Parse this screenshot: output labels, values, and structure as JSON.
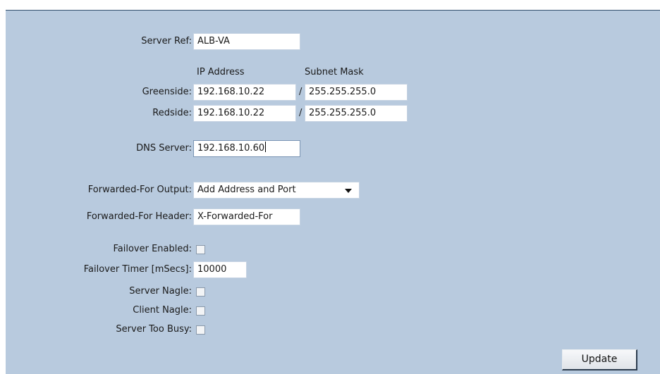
{
  "server_ref": {
    "label": "Server Ref:",
    "value": "ALB-VA"
  },
  "columns": {
    "ip": "IP Address",
    "subnet": "Subnet Mask"
  },
  "greenside": {
    "label": "Greenside:",
    "ip": "192.168.10.22",
    "separator": "/",
    "subnet": "255.255.255.0"
  },
  "redside": {
    "label": "Redside:",
    "ip": "192.168.10.22",
    "separator": "/",
    "subnet": "255.255.255.0"
  },
  "dns": {
    "label": "DNS Server:",
    "value": "192.168.10.60"
  },
  "ff_output": {
    "label": "Forwarded-For Output:",
    "value": "Add Address and Port"
  },
  "ff_header": {
    "label": "Forwarded-For Header:",
    "value": "X-Forwarded-For"
  },
  "failover_enabled": {
    "label": "Failover Enabled:",
    "checked": false
  },
  "failover_timer": {
    "label": "Failover Timer [mSecs]:",
    "value": "10000"
  },
  "server_nagle": {
    "label": "Server Nagle:",
    "checked": false
  },
  "client_nagle": {
    "label": "Client Nagle:",
    "checked": false
  },
  "server_too_busy": {
    "label": "Server Too Busy:",
    "checked": false
  },
  "update_label": "Update",
  "colors": {
    "panel_bg": "#b8cade",
    "panel_border": "#33506e",
    "field_bg": "#ffffff"
  }
}
